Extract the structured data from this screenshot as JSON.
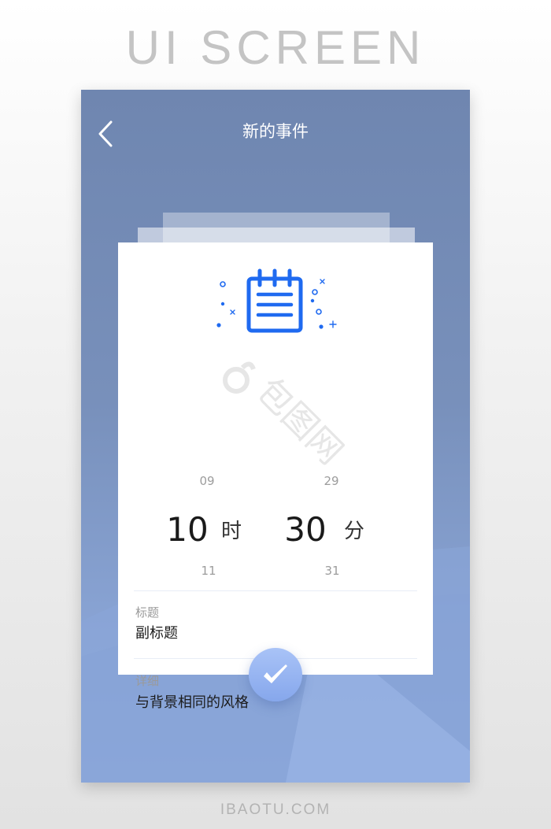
{
  "banner": {
    "title": "UI SCREEN"
  },
  "footer": {
    "brand": "IBAOTU.COM"
  },
  "header": {
    "title": "新的事件",
    "back_icon": "chevron-left-icon"
  },
  "illustration": {
    "icon": "notepad-icon",
    "accent_color": "#1f6af0"
  },
  "watermark": {
    "text": "包图网"
  },
  "time_picker": {
    "hour": {
      "prev": "09",
      "current": "10",
      "next": "11",
      "unit": "时"
    },
    "minute": {
      "prev": "29",
      "current": "30",
      "next": "31",
      "unit": "分"
    }
  },
  "fields": {
    "title": {
      "label": "标题",
      "value": "副标题"
    },
    "detail": {
      "label": "详细",
      "value": "与背景相同的风格"
    }
  },
  "confirm": {
    "icon": "checkmark-icon"
  },
  "colors": {
    "phone_bg_top": "#6f86b0",
    "phone_bg_bottom": "#93b0e2",
    "confirm_button": "#94b2f0"
  }
}
